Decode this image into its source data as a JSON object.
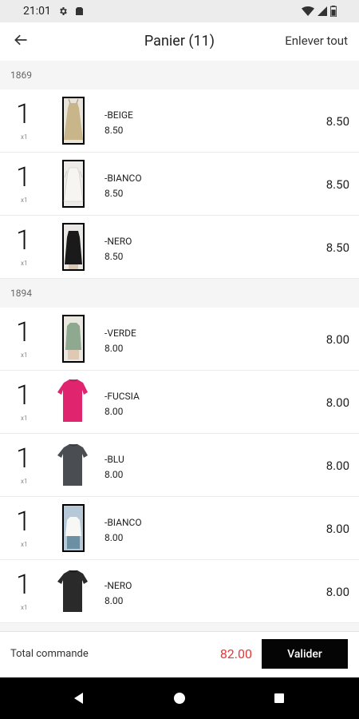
{
  "status_bar": {
    "time": "21:01"
  },
  "header": {
    "back_icon": "arrow-left-icon",
    "title": "Panier (11)",
    "clear_all_label": "Enlever tout"
  },
  "sections": [
    {
      "header": "1869",
      "items": [
        {
          "qty": "1",
          "qty_sub": "x1",
          "name": "-BEIGE",
          "unit_price": "8.50",
          "total": "8.50",
          "thumb": "beige-dress-image"
        },
        {
          "qty": "1",
          "qty_sub": "x1",
          "name": "-BIANCO",
          "unit_price": "8.50",
          "total": "8.50",
          "thumb": "white-dress-image"
        },
        {
          "qty": "1",
          "qty_sub": "x1",
          "name": "-NERO",
          "unit_price": "8.50",
          "total": "8.50",
          "thumb": "black-dress-image"
        }
      ]
    },
    {
      "header": "1894",
      "items": [
        {
          "qty": "1",
          "qty_sub": "x1",
          "name": "-VERDE",
          "unit_price": "8.00",
          "total": "8.00",
          "thumb": "green-top-image"
        },
        {
          "qty": "1",
          "qty_sub": "x1",
          "name": "-FUCSIA",
          "unit_price": "8.00",
          "total": "8.00",
          "thumb": "fuchsia-top-image"
        },
        {
          "qty": "1",
          "qty_sub": "x1",
          "name": "-BLU",
          "unit_price": "8.00",
          "total": "8.00",
          "thumb": "blue-top-image"
        },
        {
          "qty": "1",
          "qty_sub": "x1",
          "name": "-BIANCO",
          "unit_price": "8.00",
          "total": "8.00",
          "thumb": "white-top-image"
        },
        {
          "qty": "1",
          "qty_sub": "x1",
          "name": "-NERO",
          "unit_price": "8.00",
          "total": "8.00",
          "thumb": "black-top-image"
        }
      ]
    }
  ],
  "footer": {
    "total_label": "Total commande",
    "total_value": "82.00",
    "validate_label": "Valider"
  },
  "colors": {
    "total_red": "#e53935",
    "button_black": "#050505"
  }
}
